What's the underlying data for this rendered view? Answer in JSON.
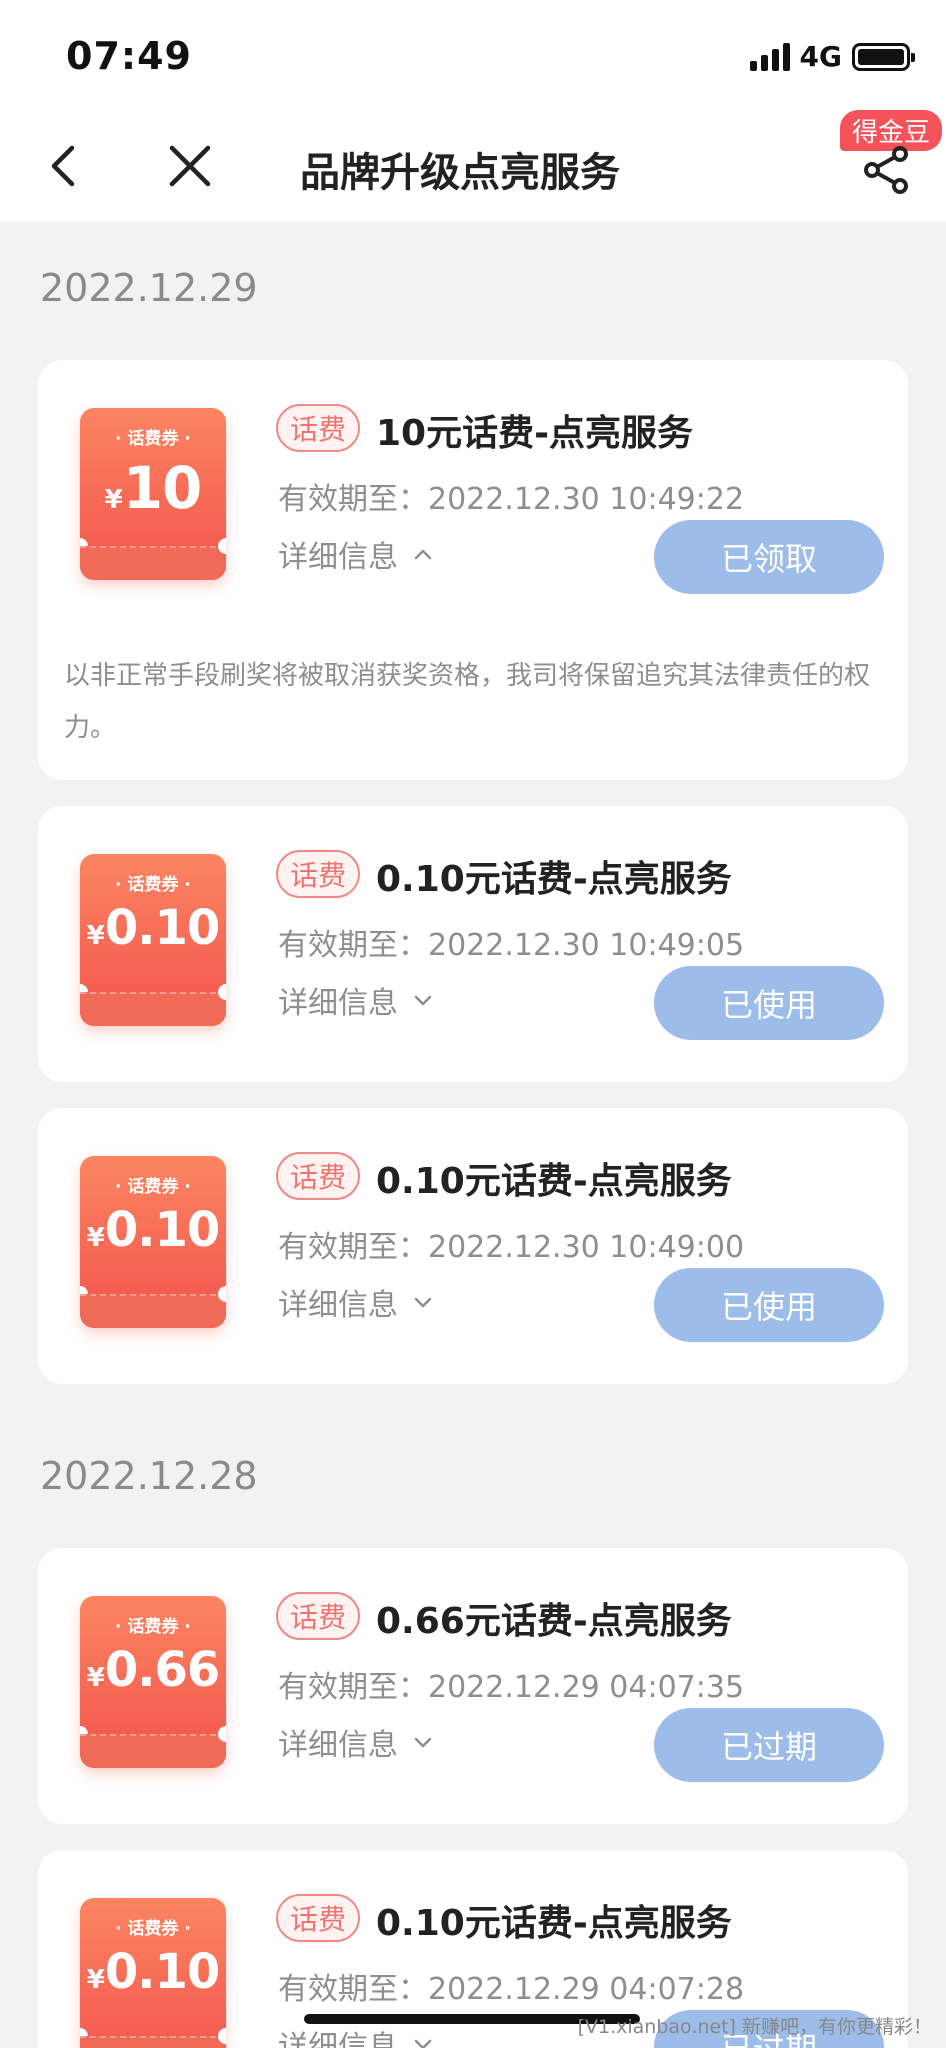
{
  "status_bar": {
    "time": "07:49",
    "network": "4G"
  },
  "nav": {
    "title": "品牌升级点亮服务",
    "badge": "得金豆"
  },
  "sections": [
    {
      "date": "2022.12.29"
    },
    {
      "date": "2022.12.28"
    }
  ],
  "coupon_label": "· 话费券 ·",
  "coupon_currency": "¥",
  "tag_label": "话费",
  "expiry_prefix": "有效期至：",
  "detail_label": "详细信息",
  "cards": [
    {
      "amount": "10",
      "title": "10元话费-点亮服务",
      "expiry": "2022.12.30 10:49:22",
      "status": "已领取",
      "expanded": true,
      "disclaimer": "以非正常手段刷奖将被取消获奖资格，我司将保留追究其法律责任的权力。"
    },
    {
      "amount": "0.10",
      "title": "0.10元话费-点亮服务",
      "expiry": "2022.12.30 10:49:05",
      "status": "已使用",
      "expanded": false
    },
    {
      "amount": "0.10",
      "title": "0.10元话费-点亮服务",
      "expiry": "2022.12.30 10:49:00",
      "status": "已使用",
      "expanded": false
    },
    {
      "amount": "0.66",
      "title": "0.66元话费-点亮服务",
      "expiry": "2022.12.29 04:07:35",
      "status": "已过期",
      "expanded": false
    },
    {
      "amount": "0.10",
      "title": "0.10元话费-点亮服务",
      "expiry": "2022.12.29 04:07:28",
      "status": "已过期",
      "expanded": false
    }
  ],
  "watermark": "[V1.xianbao.net] 新赚吧，有你更精彩！",
  "colors": {
    "status_button": "#9cbce9",
    "coupon_red": "#f3534d",
    "tag_red": "#f07370",
    "badge": "#f5525a"
  }
}
